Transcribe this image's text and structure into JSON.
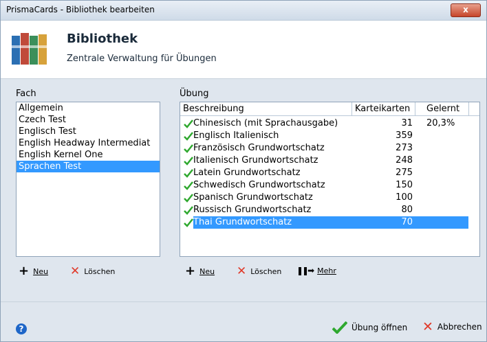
{
  "window": {
    "title": "PrismaCards - Bibliothek bearbeiten",
    "close_label": "x"
  },
  "header": {
    "title": "Bibliothek",
    "subtitle": "Zentrale Verwaltung für Übungen"
  },
  "fach": {
    "label": "Fach",
    "items": [
      "Allgemein",
      "Czech Test",
      "Englisch Test",
      "English Headway Intermediat",
      "English Kernel One",
      "Sprachen Test"
    ],
    "selected_index": 5,
    "new_label": "Neu",
    "delete_label": "Löschen"
  },
  "ubung": {
    "label": "Übung",
    "columns": [
      "Beschreibung",
      "Karteikarten",
      "Gelernt"
    ],
    "rows": [
      {
        "name": "Chinesisch (mit Sprachausgabe)",
        "cards": "31",
        "learned": "20,3%"
      },
      {
        "name": "Englisch Italienisch",
        "cards": "359",
        "learned": ""
      },
      {
        "name": "Französisch Grundwortschatz",
        "cards": "273",
        "learned": ""
      },
      {
        "name": "Italienisch Grundwortschatz",
        "cards": "248",
        "learned": ""
      },
      {
        "name": "Latein Grundwortschatz",
        "cards": "275",
        "learned": ""
      },
      {
        "name": "Schwedisch Grundwortschatz",
        "cards": "150",
        "learned": ""
      },
      {
        "name": "Spanisch Grundwortschatz",
        "cards": "100",
        "learned": ""
      },
      {
        "name": "Russisch Grundwortschatz",
        "cards": "80",
        "learned": ""
      },
      {
        "name": "Thai Grundwortschatz",
        "cards": "70",
        "learned": ""
      }
    ],
    "selected_index": 8,
    "new_label": "Neu",
    "delete_label": "Löschen",
    "more_label": "Mehr"
  },
  "footer": {
    "open_label": "Übung öffnen",
    "cancel_label": "Abbrechen",
    "help_icon": "?"
  },
  "colors": {
    "selection": "#3399ff",
    "check": "#2fa82f",
    "delete": "#e03a2a"
  }
}
